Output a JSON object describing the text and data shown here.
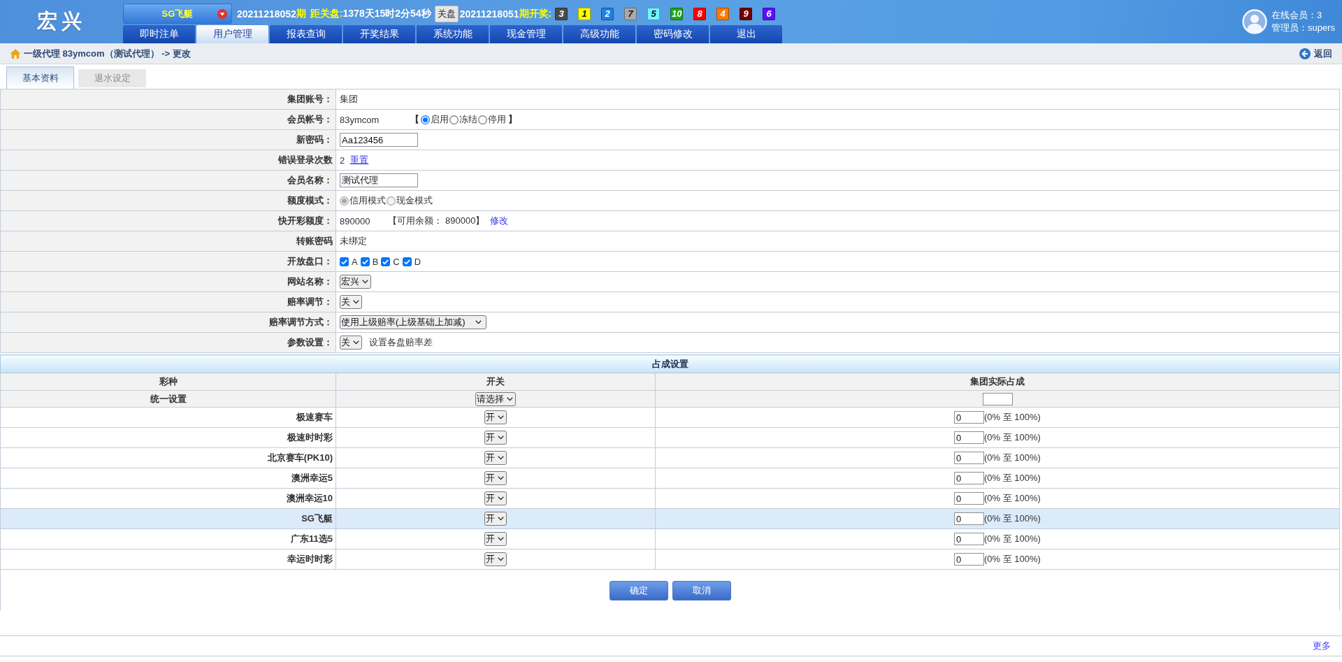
{
  "header": {
    "logo": "宏兴",
    "game": "SG飞艇",
    "issue": "20211218052",
    "issue_unit": "期",
    "countdown_label": "距关盘:",
    "countdown": "1378天15时2分54秒",
    "status_badge": "关盘",
    "last_issue": "20211218051",
    "last_label": "期开奖:",
    "balls": [
      {
        "number": "3",
        "color": "#4a4a4a"
      },
      {
        "number": "1",
        "color": "#ffff00"
      },
      {
        "number": "2",
        "color": "#1e7fe6"
      },
      {
        "number": "7",
        "color": "#a9a9a9"
      },
      {
        "number": "5",
        "color": "#70f5ff"
      },
      {
        "number": "10",
        "color": "#1aa81a"
      },
      {
        "number": "8",
        "color": "#ff0000"
      },
      {
        "number": "4",
        "color": "#ff7800"
      },
      {
        "number": "9",
        "color": "#6e0000"
      },
      {
        "number": "6",
        "color": "#5a10ff"
      }
    ]
  },
  "nav": [
    {
      "label": "即时注单",
      "selected": false
    },
    {
      "label": "用户管理",
      "selected": true
    },
    {
      "label": "报表查询",
      "selected": false
    },
    {
      "label": "开奖结果",
      "selected": false
    },
    {
      "label": "系统功能",
      "selected": false
    },
    {
      "label": "现金管理",
      "selected": false
    },
    {
      "label": "高级功能",
      "selected": false
    },
    {
      "label": "密码修改",
      "selected": false
    },
    {
      "label": "退出",
      "selected": false
    }
  ],
  "user_info": {
    "online": "在线会员：3",
    "admin": "管理员：supers"
  },
  "breadcrumb": {
    "text": "一级代理 83ymcom（测试代理） -> 更改",
    "back": "返回"
  },
  "tabs": [
    {
      "label": "基本资料",
      "selected": true
    },
    {
      "label": "退水设定",
      "selected": false
    }
  ],
  "form": [
    {
      "kind": "text",
      "label": "集团账号：",
      "value": "集团"
    },
    {
      "kind": "radios",
      "label": "会员帐号：",
      "value": "83ymcom",
      "open": "【",
      "close": "】",
      "disabled": false,
      "options": [
        {
          "label": "启用",
          "selected": true
        },
        {
          "label": "冻结",
          "selected": false
        },
        {
          "label": "停用",
          "selected": false
        }
      ]
    },
    {
      "kind": "input",
      "label": "新密码：",
      "value": "Aa123456"
    },
    {
      "kind": "count",
      "label": "错误登录次数",
      "value": "2",
      "link": "重置"
    },
    {
      "kind": "input",
      "label": "会员名称：",
      "value": "测试代理"
    },
    {
      "kind": "radios",
      "label": "额度模式：",
      "disabled": true,
      "options": [
        {
          "label": "信用模式",
          "selected": true
        },
        {
          "label": "现金模式",
          "selected": false
        }
      ]
    },
    {
      "kind": "credit",
      "label": "快开彩额度：",
      "value": "890000",
      "note": "【可用余额： 890000】",
      "link": "修改"
    },
    {
      "kind": "text",
      "label": "转账密码",
      "value": "未绑定"
    },
    {
      "kind": "checks",
      "label": "开放盘口：",
      "options": [
        {
          "label": "A",
          "checked": true
        },
        {
          "label": "B",
          "checked": true
        },
        {
          "label": "C",
          "checked": true
        },
        {
          "label": "D",
          "checked": true
        }
      ]
    },
    {
      "kind": "select",
      "label": "网站名称：",
      "value": "宏兴"
    },
    {
      "kind": "select",
      "label": "赔率调节：",
      "value": "关"
    },
    {
      "kind": "select",
      "label": "赔率调节方式：",
      "value": "使用上级赔率(上级基础上加减)"
    },
    {
      "kind": "select",
      "label": "参数设置：",
      "value": "关",
      "note": "设置各盘赔率差"
    }
  ],
  "share": {
    "title": "占成设置",
    "columns": [
      "彩种",
      "开关",
      "集团实际占成"
    ],
    "unified": {
      "label": "统一设置",
      "select": "请选择"
    },
    "rows": [
      {
        "name": "极速赛车",
        "switch": "开",
        "value": "0",
        "range": "(0% 至 100%)",
        "selected": false
      },
      {
        "name": "极速时时彩",
        "switch": "开",
        "value": "0",
        "range": "(0% 至 100%)",
        "selected": false
      },
      {
        "name": "北京赛车(PK10)",
        "switch": "开",
        "value": "0",
        "range": "(0% 至 100%)",
        "selected": false
      },
      {
        "name": "澳洲幸运5",
        "switch": "开",
        "value": "0",
        "range": "(0% 至 100%)",
        "selected": false
      },
      {
        "name": "澳洲幸运10",
        "switch": "开",
        "value": "0",
        "range": "(0% 至 100%)",
        "selected": false
      },
      {
        "name": "SG飞艇",
        "switch": "开",
        "value": "0",
        "range": "(0% 至 100%)",
        "selected": true
      },
      {
        "name": "广东11选5",
        "switch": "开",
        "value": "0",
        "range": "(0% 至 100%)",
        "selected": false
      },
      {
        "name": "幸运时时彩",
        "switch": "开",
        "value": "0",
        "range": "(0% 至 100%)",
        "selected": false
      }
    ]
  },
  "buttons": [
    "确定",
    "取消"
  ],
  "footer": {
    "more": "更多"
  }
}
